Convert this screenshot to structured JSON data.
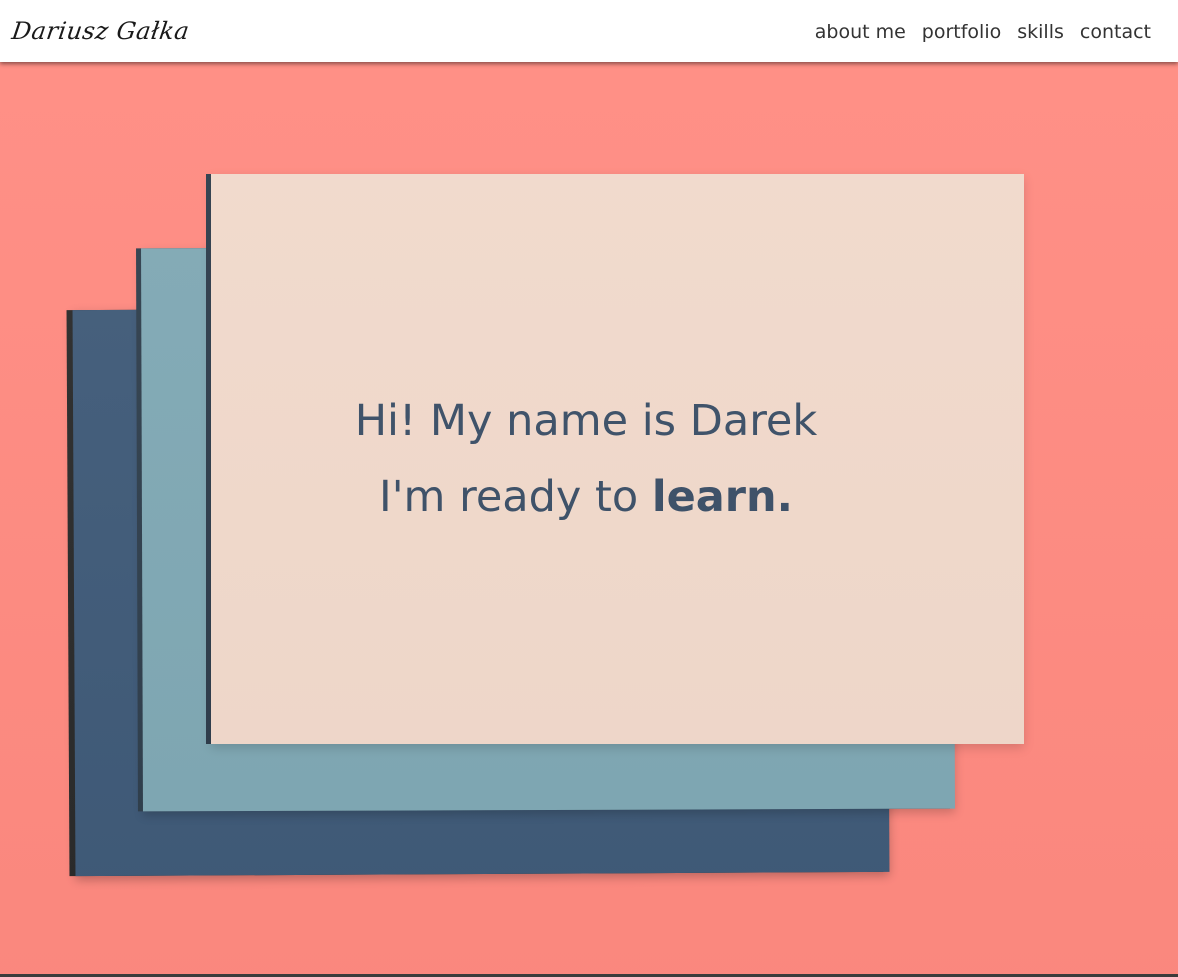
{
  "nav": {
    "logo": "Dariusz Gałka",
    "links": [
      {
        "label": "about me"
      },
      {
        "label": "portfolio"
      },
      {
        "label": "skills"
      },
      {
        "label": "contact"
      }
    ]
  },
  "hero": {
    "line1": "Hi! My name is Darek",
    "line2_prefix": "I'm ready to ",
    "line2_emphasis": "learn."
  },
  "colors": {
    "background": "#ff8a80",
    "paper_cream": "#f1d9cb",
    "paper_teal": "#7fa8b4",
    "paper_navy": "#3f5a78",
    "text": "#3a4e66"
  }
}
